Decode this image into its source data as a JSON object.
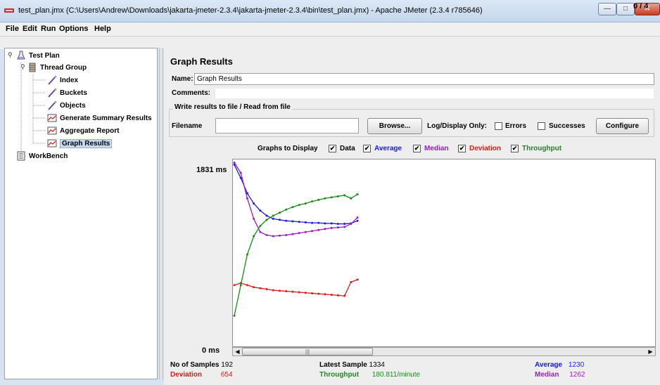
{
  "window": {
    "title": "test_plan.jmx (C:\\Users\\Andrew\\Downloads\\jakarta-jmeter-2.3.4\\jakarta-jmeter-2.3.4\\bin\\test_plan.jmx) - Apache JMeter (2.3.4 r785646)",
    "minimize": "—",
    "maximize": "□",
    "close": "✕"
  },
  "menu": {
    "items": [
      "File",
      "Edit",
      "Run",
      "Options",
      "Help"
    ]
  },
  "toolbar": {
    "counter": "0 / 4"
  },
  "tree": {
    "items": [
      {
        "label": "Test Plan",
        "icon": "test-plan-icon"
      },
      {
        "label": "Thread Group",
        "icon": "thread-group-icon"
      },
      {
        "label": "Index",
        "icon": "sampler-icon"
      },
      {
        "label": "Buckets",
        "icon": "sampler-icon"
      },
      {
        "label": "Objects",
        "icon": "sampler-icon"
      },
      {
        "label": "Generate Summary Results",
        "icon": "listener-icon"
      },
      {
        "label": "Aggregate Report",
        "icon": "listener-icon"
      },
      {
        "label": "Graph Results",
        "icon": "listener-icon"
      },
      {
        "label": "WorkBench",
        "icon": "workbench-icon"
      }
    ]
  },
  "panel": {
    "title": "Graph Results",
    "name_label": "Name:",
    "name_value": "Graph Results",
    "comments_label": "Comments:",
    "file_legend": "Write results to file / Read from file",
    "filename_label": "Filename",
    "filename_value": "",
    "browse": "Browse...",
    "log_display_label": "Log/Display Only:",
    "errors_label": "Errors",
    "successes_label": "Successes",
    "configure": "Configure"
  },
  "graphs_to_display": {
    "label": "Graphs to Display",
    "items": [
      {
        "label": "Data",
        "checked": true,
        "color": "#000000"
      },
      {
        "label": "Average",
        "checked": true,
        "color": "#1a1af0"
      },
      {
        "label": "Median",
        "checked": true,
        "color": "#9b1fb8"
      },
      {
        "label": "Deviation",
        "checked": true,
        "color": "#e01a1a"
      },
      {
        "label": "Throughput",
        "checked": true,
        "color": "#1a8a1a"
      }
    ]
  },
  "graph": {
    "y_max_label": "1831 ms",
    "y_min_label": "0 ms"
  },
  "stats": {
    "samples_label": "No of Samples",
    "samples_value": "192",
    "latest_label": "Latest Sample",
    "latest_value": "1334",
    "average_label": "Average",
    "average_value": "1230",
    "deviation_label": "Deviation",
    "deviation_value": "654",
    "throughput_label": "Throughput",
    "throughput_value": "180.811/minute",
    "median_label": "Median",
    "median_value": "1262"
  },
  "chart_data": {
    "type": "scatter",
    "ylim": [
      0,
      1831
    ],
    "series": [
      {
        "name": "Average",
        "color": "#1a1af0",
        "values": [
          1780,
          1650,
          1500,
          1400,
          1330,
          1280,
          1250,
          1240,
          1230,
          1225,
          1220,
          1215,
          1210,
          1210,
          1205,
          1205,
          1200,
          1200,
          1205,
          1230
        ]
      },
      {
        "name": "Median",
        "color": "#9b1fb8",
        "values": [
          1800,
          1700,
          1450,
          1250,
          1120,
          1090,
          1080,
          1085,
          1090,
          1100,
          1110,
          1120,
          1130,
          1140,
          1150,
          1160,
          1165,
          1170,
          1200,
          1262
        ]
      },
      {
        "name": "Deviation",
        "color": "#e01a1a",
        "values": [
          600,
          620,
          600,
          580,
          570,
          560,
          550,
          545,
          540,
          535,
          530,
          525,
          520,
          515,
          510,
          505,
          500,
          495,
          630,
          654
        ]
      },
      {
        "name": "Throughput",
        "color": "#1a8a1a",
        "values": [
          300,
          600,
          900,
          1080,
          1180,
          1240,
          1280,
          1310,
          1340,
          1365,
          1385,
          1400,
          1420,
          1435,
          1450,
          1460,
          1470,
          1480,
          1450,
          1490
        ]
      }
    ]
  }
}
